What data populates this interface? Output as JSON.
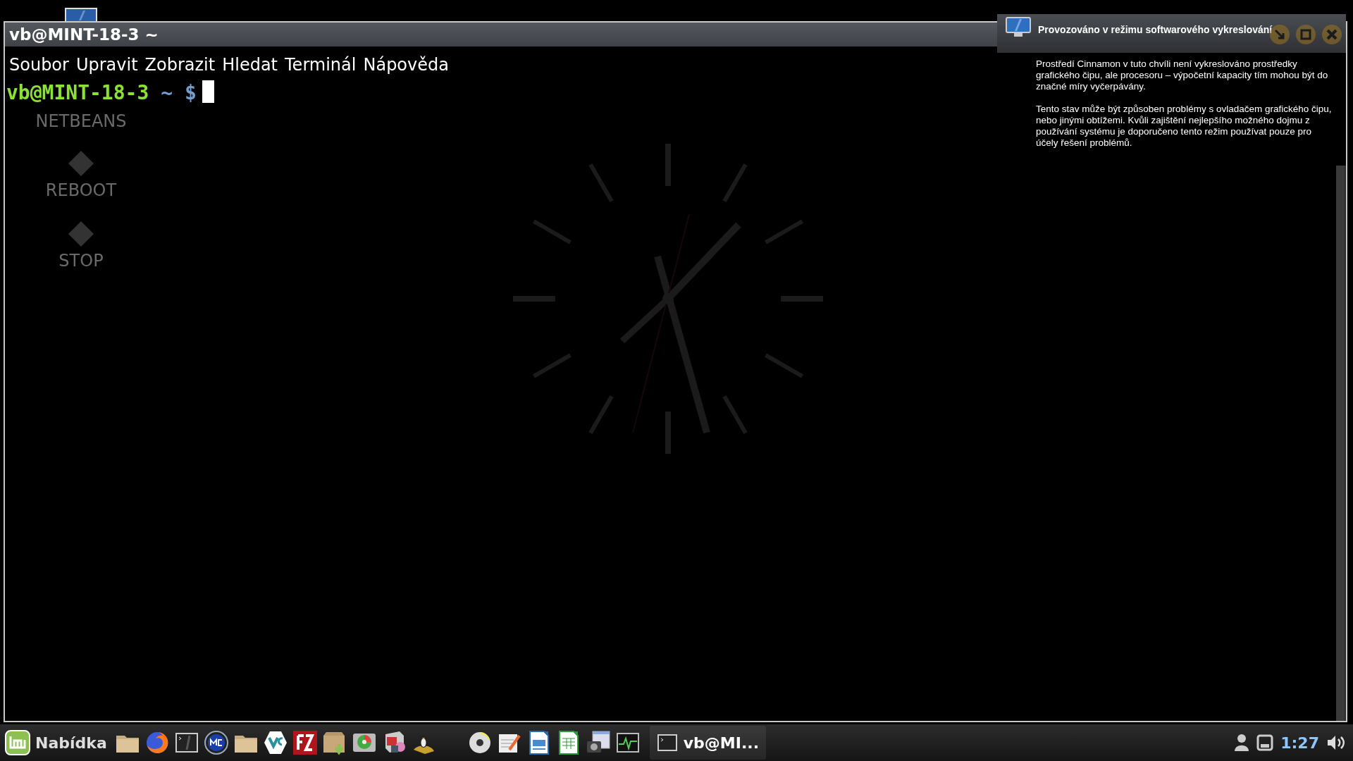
{
  "desktop": {
    "icons": [
      {
        "label": "NETBEANS"
      },
      {
        "label": "REBOOT"
      },
      {
        "label": "STOP"
      }
    ]
  },
  "terminal": {
    "title": "vb@MINT-18-3 ~",
    "menu": [
      "Soubor",
      "Upravit",
      "Zobrazit",
      "Hledat",
      "Terminál",
      "Nápověda"
    ],
    "prompt": {
      "user_host": "vb@MINT-18-3",
      "path": "~",
      "symbol": "$"
    }
  },
  "notification": {
    "title": "Provozováno v režimu softwarového vykreslování",
    "paragraphs": [
      "Prostředí Cinnamon v tuto chvíli není vykreslováno prostředky grafického čipu, ale procesoru – výpočetní kapacity tím mohou být do značné míry vyčerpávány.",
      "Tento stav může být způsoben problémy s ovladačem grafického čipu, nebo jinými obtížemi. Kvůli zajištění nejlepšího možného dojmu z používání systému je doporučeno tento režim používat pouze pro účely řešení problémů."
    ]
  },
  "taskbar": {
    "menu_label": "Nabídka",
    "windows": [
      {
        "label": "vb@MI...",
        "selected": true
      }
    ],
    "clock": "1:27"
  }
}
